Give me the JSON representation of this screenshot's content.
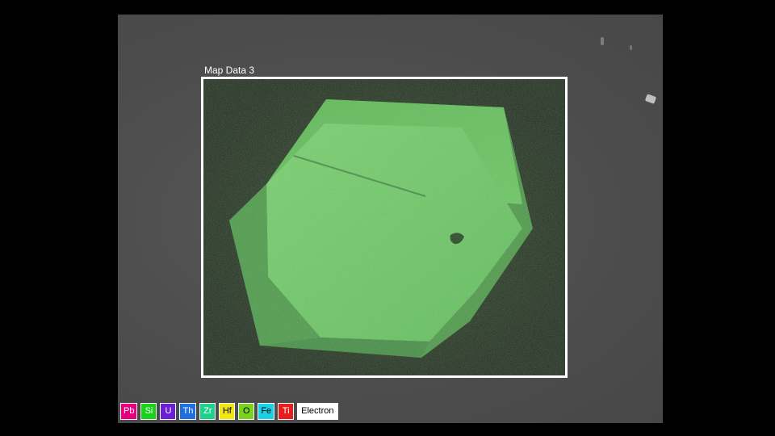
{
  "map": {
    "title": "Map Data 3"
  },
  "legend": {
    "elements": [
      {
        "label": "Pb",
        "color": "#e6007e",
        "text_color": "#ffffff"
      },
      {
        "label": "Si",
        "color": "#19d219",
        "text_color": "#ffffff"
      },
      {
        "label": "U",
        "color": "#6a1fd6",
        "text_color": "#ffffff"
      },
      {
        "label": "Th",
        "color": "#1e6fe0",
        "text_color": "#ffffff"
      },
      {
        "label": "Zr",
        "color": "#1ed28c",
        "text_color": "#ffffff"
      },
      {
        "label": "Hf",
        "color": "#f0e614",
        "text_color": "#000000"
      },
      {
        "label": "O",
        "color": "#7ad21e",
        "text_color": "#000000"
      },
      {
        "label": "Fe",
        "color": "#19d2e6",
        "text_color": "#000000"
      },
      {
        "label": "Ti",
        "color": "#e61e1e",
        "text_color": "#ffffff"
      }
    ],
    "electron_label": "Electron"
  },
  "colors": {
    "frame_border": "#ffffff",
    "crystal_main": "#6fd25a",
    "background": "#474747"
  }
}
